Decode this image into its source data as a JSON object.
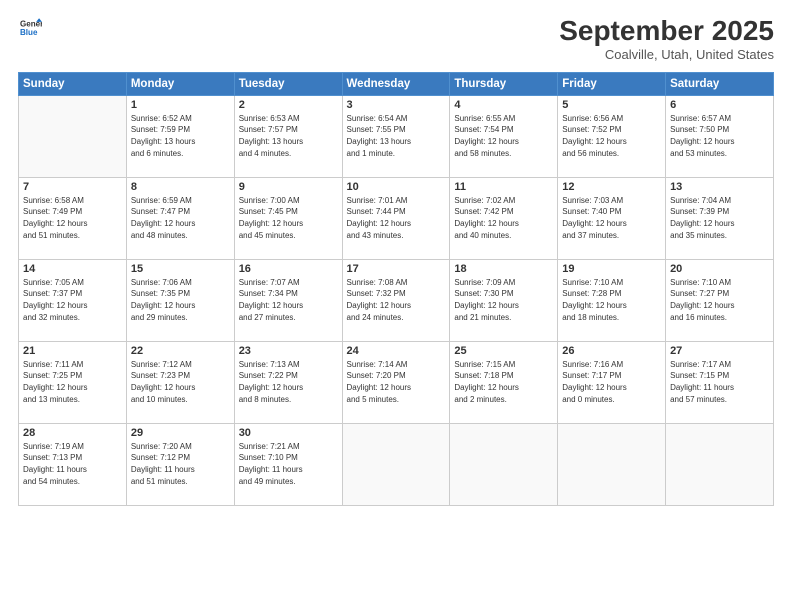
{
  "header": {
    "logo": {
      "line1": "General",
      "line2": "Blue"
    },
    "title": "September 2025",
    "location": "Coalville, Utah, United States"
  },
  "weekdays": [
    "Sunday",
    "Monday",
    "Tuesday",
    "Wednesday",
    "Thursday",
    "Friday",
    "Saturday"
  ],
  "weeks": [
    [
      {
        "day": "",
        "info": ""
      },
      {
        "day": "1",
        "info": "Sunrise: 6:52 AM\nSunset: 7:59 PM\nDaylight: 13 hours\nand 6 minutes."
      },
      {
        "day": "2",
        "info": "Sunrise: 6:53 AM\nSunset: 7:57 PM\nDaylight: 13 hours\nand 4 minutes."
      },
      {
        "day": "3",
        "info": "Sunrise: 6:54 AM\nSunset: 7:55 PM\nDaylight: 13 hours\nand 1 minute."
      },
      {
        "day": "4",
        "info": "Sunrise: 6:55 AM\nSunset: 7:54 PM\nDaylight: 12 hours\nand 58 minutes."
      },
      {
        "day": "5",
        "info": "Sunrise: 6:56 AM\nSunset: 7:52 PM\nDaylight: 12 hours\nand 56 minutes."
      },
      {
        "day": "6",
        "info": "Sunrise: 6:57 AM\nSunset: 7:50 PM\nDaylight: 12 hours\nand 53 minutes."
      }
    ],
    [
      {
        "day": "7",
        "info": "Sunrise: 6:58 AM\nSunset: 7:49 PM\nDaylight: 12 hours\nand 51 minutes."
      },
      {
        "day": "8",
        "info": "Sunrise: 6:59 AM\nSunset: 7:47 PM\nDaylight: 12 hours\nand 48 minutes."
      },
      {
        "day": "9",
        "info": "Sunrise: 7:00 AM\nSunset: 7:45 PM\nDaylight: 12 hours\nand 45 minutes."
      },
      {
        "day": "10",
        "info": "Sunrise: 7:01 AM\nSunset: 7:44 PM\nDaylight: 12 hours\nand 43 minutes."
      },
      {
        "day": "11",
        "info": "Sunrise: 7:02 AM\nSunset: 7:42 PM\nDaylight: 12 hours\nand 40 minutes."
      },
      {
        "day": "12",
        "info": "Sunrise: 7:03 AM\nSunset: 7:40 PM\nDaylight: 12 hours\nand 37 minutes."
      },
      {
        "day": "13",
        "info": "Sunrise: 7:04 AM\nSunset: 7:39 PM\nDaylight: 12 hours\nand 35 minutes."
      }
    ],
    [
      {
        "day": "14",
        "info": "Sunrise: 7:05 AM\nSunset: 7:37 PM\nDaylight: 12 hours\nand 32 minutes."
      },
      {
        "day": "15",
        "info": "Sunrise: 7:06 AM\nSunset: 7:35 PM\nDaylight: 12 hours\nand 29 minutes."
      },
      {
        "day": "16",
        "info": "Sunrise: 7:07 AM\nSunset: 7:34 PM\nDaylight: 12 hours\nand 27 minutes."
      },
      {
        "day": "17",
        "info": "Sunrise: 7:08 AM\nSunset: 7:32 PM\nDaylight: 12 hours\nand 24 minutes."
      },
      {
        "day": "18",
        "info": "Sunrise: 7:09 AM\nSunset: 7:30 PM\nDaylight: 12 hours\nand 21 minutes."
      },
      {
        "day": "19",
        "info": "Sunrise: 7:10 AM\nSunset: 7:28 PM\nDaylight: 12 hours\nand 18 minutes."
      },
      {
        "day": "20",
        "info": "Sunrise: 7:10 AM\nSunset: 7:27 PM\nDaylight: 12 hours\nand 16 minutes."
      }
    ],
    [
      {
        "day": "21",
        "info": "Sunrise: 7:11 AM\nSunset: 7:25 PM\nDaylight: 12 hours\nand 13 minutes."
      },
      {
        "day": "22",
        "info": "Sunrise: 7:12 AM\nSunset: 7:23 PM\nDaylight: 12 hours\nand 10 minutes."
      },
      {
        "day": "23",
        "info": "Sunrise: 7:13 AM\nSunset: 7:22 PM\nDaylight: 12 hours\nand 8 minutes."
      },
      {
        "day": "24",
        "info": "Sunrise: 7:14 AM\nSunset: 7:20 PM\nDaylight: 12 hours\nand 5 minutes."
      },
      {
        "day": "25",
        "info": "Sunrise: 7:15 AM\nSunset: 7:18 PM\nDaylight: 12 hours\nand 2 minutes."
      },
      {
        "day": "26",
        "info": "Sunrise: 7:16 AM\nSunset: 7:17 PM\nDaylight: 12 hours\nand 0 minutes."
      },
      {
        "day": "27",
        "info": "Sunrise: 7:17 AM\nSunset: 7:15 PM\nDaylight: 11 hours\nand 57 minutes."
      }
    ],
    [
      {
        "day": "28",
        "info": "Sunrise: 7:19 AM\nSunset: 7:13 PM\nDaylight: 11 hours\nand 54 minutes."
      },
      {
        "day": "29",
        "info": "Sunrise: 7:20 AM\nSunset: 7:12 PM\nDaylight: 11 hours\nand 51 minutes."
      },
      {
        "day": "30",
        "info": "Sunrise: 7:21 AM\nSunset: 7:10 PM\nDaylight: 11 hours\nand 49 minutes."
      },
      {
        "day": "",
        "info": ""
      },
      {
        "day": "",
        "info": ""
      },
      {
        "day": "",
        "info": ""
      },
      {
        "day": "",
        "info": ""
      }
    ]
  ]
}
